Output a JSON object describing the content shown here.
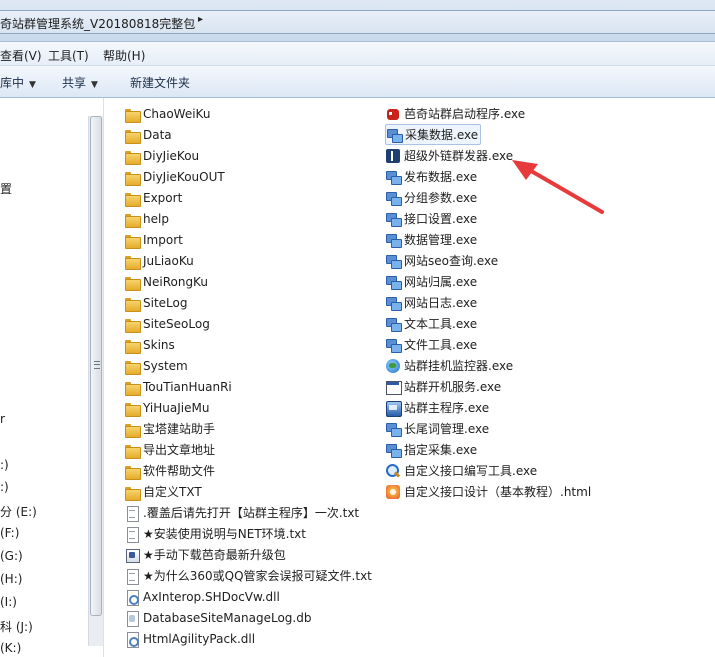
{
  "address_bar": {
    "path": "奇站群管理系统_V20180818完整包",
    "separator": "▸"
  },
  "menu": [
    "查看(V)",
    "工具(T)",
    "帮助(H)"
  ],
  "toolbar": {
    "include_in_library": "库中",
    "share": "共享",
    "new_folder": "新建文件夹"
  },
  "nav": {
    "items": [
      "置",
      "r",
      ":)",
      ":)",
      "分 (E:)",
      "(F:)",
      "(G:)",
      "(H:)",
      "(I:)",
      "科 (J:)",
      "(K:)"
    ]
  },
  "left_column": [
    {
      "name": "ChaoWeiKu",
      "icon": "folder-icon"
    },
    {
      "name": "Data",
      "icon": "folder-icon"
    },
    {
      "name": "DiyJieKou",
      "icon": "folder-icon"
    },
    {
      "name": "DiyJieKouOUT",
      "icon": "folder-icon"
    },
    {
      "name": "Export",
      "icon": "folder-icon"
    },
    {
      "name": "help",
      "icon": "folder-icon"
    },
    {
      "name": "Import",
      "icon": "folder-icon"
    },
    {
      "name": "JuLiaoKu",
      "icon": "folder-icon"
    },
    {
      "name": "NeiRongKu",
      "icon": "folder-icon"
    },
    {
      "name": "SiteLog",
      "icon": "folder-icon"
    },
    {
      "name": "SiteSeoLog",
      "icon": "folder-icon"
    },
    {
      "name": "Skins",
      "icon": "folder-icon"
    },
    {
      "name": "System",
      "icon": "folder-icon"
    },
    {
      "name": "TouTianHuanRi",
      "icon": "folder-icon"
    },
    {
      "name": "YiHuaJieMu",
      "icon": "folder-icon"
    },
    {
      "name": "宝塔建站助手",
      "icon": "folder-icon"
    },
    {
      "name": "导出文章地址",
      "icon": "folder-icon"
    },
    {
      "name": "软件帮助文件",
      "icon": "folder-icon"
    },
    {
      "name": "自定义TXT",
      "icon": "folder-icon"
    },
    {
      "name": ".覆盖后请先打开【站群主程序】一次.txt",
      "icon": "text-file-icon"
    },
    {
      "name": "★安装使用说明与NET环境.txt",
      "icon": "text-file-icon"
    },
    {
      "name": "★手动下载芭奇最新升级包",
      "icon": "package-icon"
    },
    {
      "name": "★为什么360或QQ管家会误报可疑文件.txt",
      "icon": "text-file-icon"
    },
    {
      "name": "AxInterop.SHDocVw.dll",
      "icon": "dll-icon"
    },
    {
      "name": "DatabaseSiteManageLog.db",
      "icon": "database-file-icon"
    },
    {
      "name": "HtmlAgilityPack.dll",
      "icon": "dll-icon"
    }
  ],
  "right_column": [
    {
      "name": "芭奇站群启动程序.exe",
      "icon": "robot-icon"
    },
    {
      "name": "采集数据.exe",
      "icon": "network-exe-icon",
      "selected": true
    },
    {
      "name": "超级外链群发器.exe",
      "icon": "bluetooth-icon"
    },
    {
      "name": "发布数据.exe",
      "icon": "network-exe-icon"
    },
    {
      "name": "分组参数.exe",
      "icon": "network-exe-icon"
    },
    {
      "name": "接口设置.exe",
      "icon": "network-exe-icon"
    },
    {
      "name": "数据管理.exe",
      "icon": "network-exe-icon"
    },
    {
      "name": "网站seo查询.exe",
      "icon": "network-exe-icon"
    },
    {
      "name": "网站归属.exe",
      "icon": "network-exe-icon"
    },
    {
      "name": "网站日志.exe",
      "icon": "network-exe-icon"
    },
    {
      "name": "文本工具.exe",
      "icon": "network-exe-icon"
    },
    {
      "name": "文件工具.exe",
      "icon": "network-exe-icon"
    },
    {
      "name": "站群挂机监控器.exe",
      "icon": "globe-icon"
    },
    {
      "name": "站群开机服务.exe",
      "icon": "window-icon"
    },
    {
      "name": "站群主程序.exe",
      "icon": "app-icon"
    },
    {
      "name": "长尾词管理.exe",
      "icon": "network-exe-icon"
    },
    {
      "name": "指定采集.exe",
      "icon": "network-exe-icon"
    },
    {
      "name": "自定义接口编写工具.exe",
      "icon": "search-icon"
    },
    {
      "name": "自定义接口设计（基本教程）.html",
      "icon": "html-file-icon"
    }
  ],
  "colors": {
    "annotation_arrow": "#e8393b",
    "selection_border": "#a8c3e6",
    "folder": "#f0c452"
  }
}
